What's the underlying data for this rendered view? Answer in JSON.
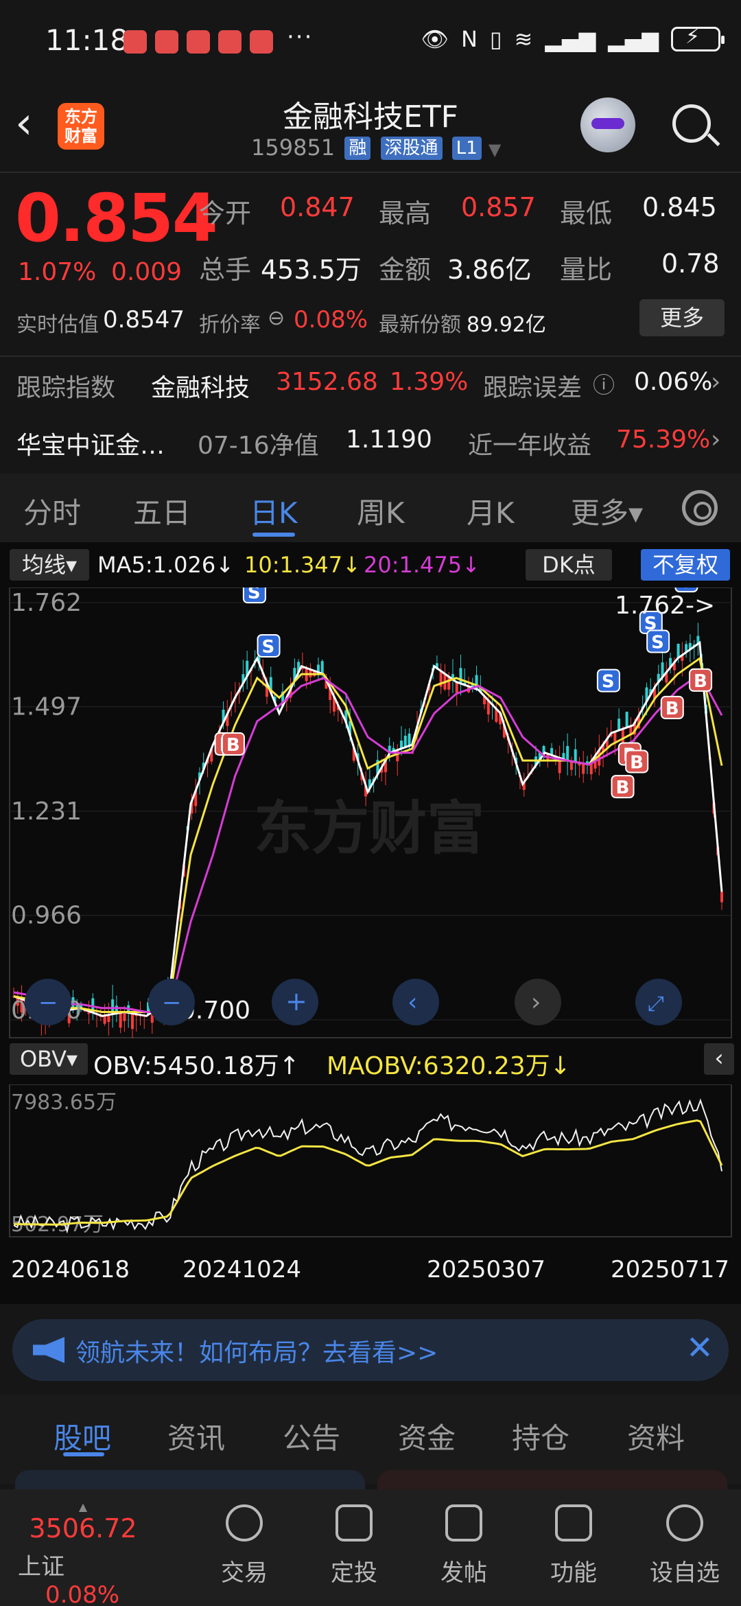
{
  "status": {
    "time": "11:18",
    "dots": "···"
  },
  "header": {
    "title": "金融科技ETF",
    "code": "159851",
    "tags": [
      "融",
      "深股通",
      "L1"
    ],
    "logo_text": "东方财富"
  },
  "quote": {
    "price": "0.854",
    "change_pct": "1.07%",
    "change": "0.009",
    "open_label": "今开",
    "open": "0.847",
    "high_label": "最高",
    "high": "0.857",
    "low_label": "最低",
    "low": "0.845",
    "volume_label": "总手",
    "volume": "453.5万",
    "amount_label": "金额",
    "amount": "3.86亿",
    "vol_ratio_label": "量比",
    "vol_ratio": "0.78",
    "iopv_label": "实时估值",
    "iopv": "0.8547",
    "discount_label": "折价率",
    "discount": "0.08%",
    "shares_label": "最新份额",
    "shares": "89.92亿",
    "more": "更多"
  },
  "tracking": {
    "index_label": "跟踪指数",
    "index_name": "金融科技",
    "index_value": "3152.68",
    "index_pct": "1.39%",
    "error_label": "跟踪误差",
    "error_value": "0.06%",
    "fund_name": "华宝中证金…",
    "nav_label": "07-16净值",
    "nav_value": "1.1190",
    "year_label": "近一年收益",
    "year_value": "75.39%"
  },
  "ktabs": [
    "分时",
    "五日",
    "日K",
    "周K",
    "月K",
    "更多▾"
  ],
  "ma": {
    "selector": "均线",
    "ma5": "MA5:1.026↓",
    "ma10": "10:1.347↓",
    "ma20": "20:1.475↓",
    "dk": "DK点",
    "adjust": "不复权"
  },
  "obv": {
    "selector": "OBV",
    "obv": "OBV:5450.18万↑",
    "maobv": "MAOBV:6320.23万↓",
    "max": "7983.65万",
    "min": "502.97万"
  },
  "chart_data": {
    "type": "line",
    "y_ticks": [
      "1.762",
      "1.497",
      "1.231",
      "0.966",
      "0.700"
    ],
    "max_label": "1.762->",
    "min_label": "0.700",
    "x_labels": [
      "20240618",
      "20241024",
      "20250307",
      "20250717"
    ],
    "ylim": [
      0.7,
      1.762
    ],
    "series": [
      {
        "name": "MA5",
        "values": [
          0.76,
          0.74,
          0.72,
          0.73,
          0.71,
          0.72,
          0.71,
          0.75,
          1.25,
          1.4,
          1.52,
          1.62,
          1.48,
          1.6,
          1.58,
          1.46,
          1.28,
          1.38,
          1.4,
          1.6,
          1.56,
          1.54,
          1.48,
          1.3,
          1.38,
          1.36,
          1.35,
          1.43,
          1.45,
          1.55,
          1.62,
          1.66,
          1.026
        ]
      },
      {
        "name": "10",
        "values": [
          0.76,
          0.75,
          0.73,
          0.73,
          0.72,
          0.72,
          0.72,
          0.73,
          1.12,
          1.3,
          1.45,
          1.57,
          1.52,
          1.58,
          1.58,
          1.5,
          1.34,
          1.37,
          1.39,
          1.55,
          1.57,
          1.55,
          1.5,
          1.36,
          1.36,
          1.36,
          1.35,
          1.4,
          1.43,
          1.52,
          1.58,
          1.62,
          1.347
        ]
      },
      {
        "name": "20",
        "values": [
          0.77,
          0.76,
          0.74,
          0.74,
          0.73,
          0.73,
          0.72,
          0.72,
          0.95,
          1.12,
          1.32,
          1.46,
          1.5,
          1.55,
          1.57,
          1.53,
          1.42,
          1.38,
          1.38,
          1.48,
          1.53,
          1.55,
          1.52,
          1.42,
          1.37,
          1.36,
          1.35,
          1.38,
          1.41,
          1.48,
          1.54,
          1.58,
          1.475
        ]
      }
    ]
  },
  "banner": {
    "text": "领航未来！如何布局？去看看>>"
  },
  "ctabs": [
    "股吧",
    "资讯",
    "公告",
    "资金",
    "持仓",
    "资料"
  ],
  "bnav": {
    "index_value": "3506.72",
    "index_name": "上证",
    "index_pct": "0.08%",
    "items": [
      "交易",
      "定投",
      "发帖",
      "功能",
      "设自选"
    ]
  },
  "watermark": "东方财富"
}
